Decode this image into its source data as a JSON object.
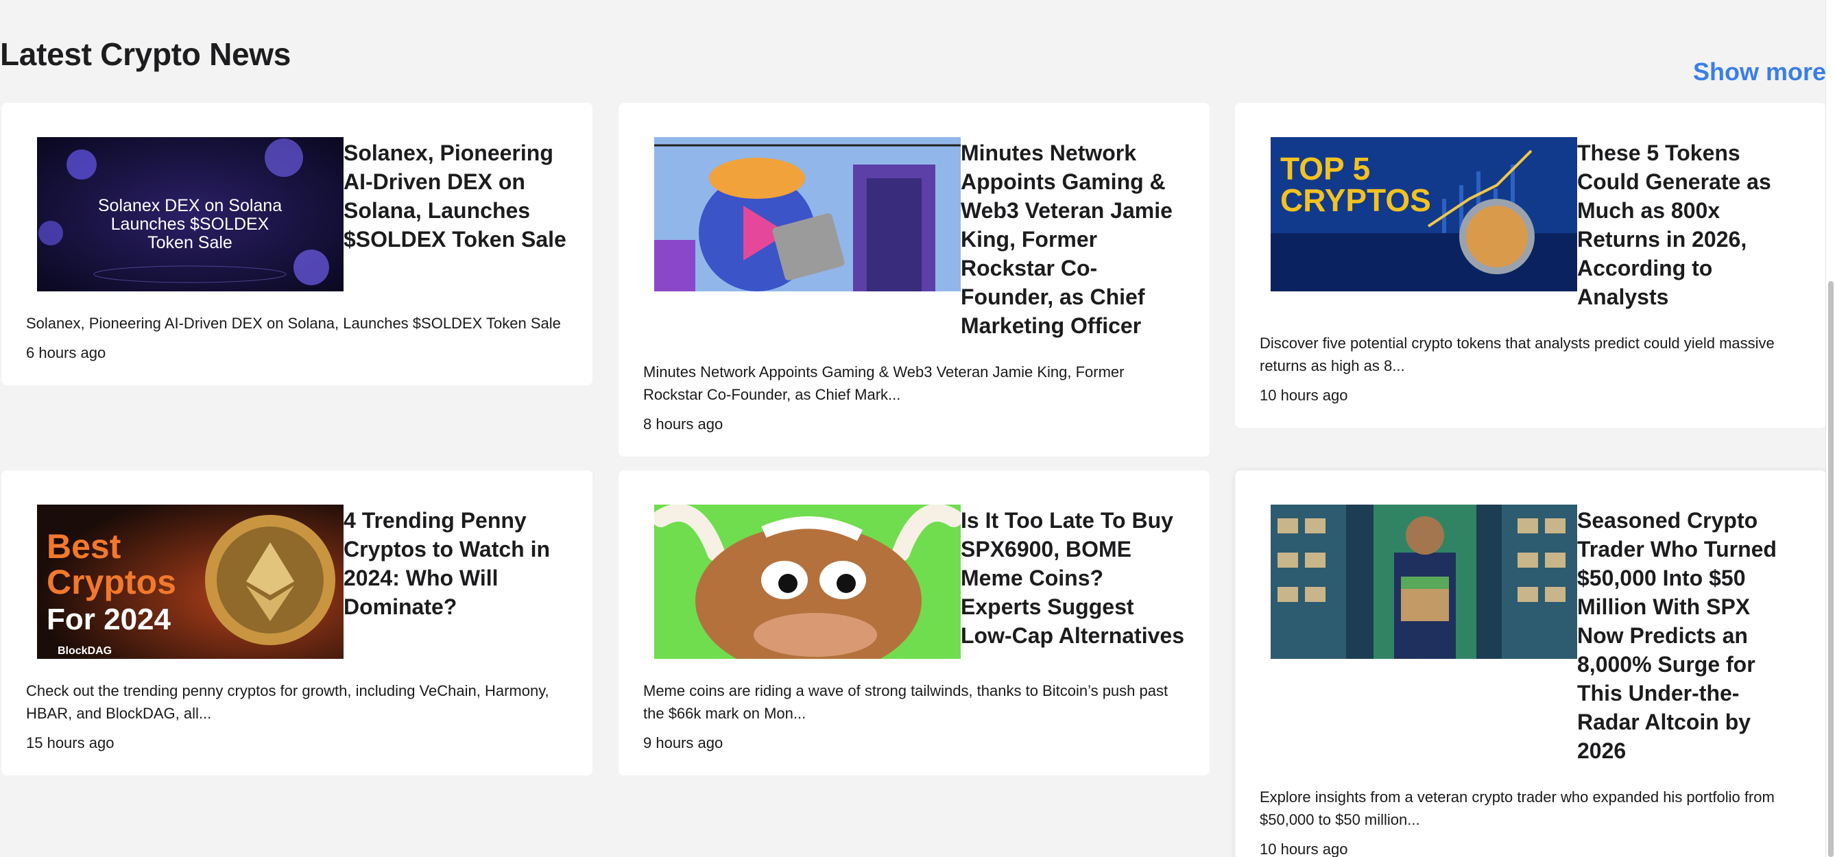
{
  "section": {
    "title": "Latest Crypto News",
    "show_more": "Show more"
  },
  "articles": [
    {
      "headline": "Solanex, Pioneering AI-Driven DEX on Solana, Launches $SOLDEX Token Sale",
      "image_text": [
        "Solanex DEX on Solana",
        "Launches $SOLDEX",
        "Token Sale"
      ],
      "excerpt": "Solanex, Pioneering AI-Driven DEX on Solana, Launches $SOLDEX Token Sale",
      "time": "6 hours ago"
    },
    {
      "headline": "Minutes Network Appoints Gaming & Web3 Veteran Jamie King, Former Rockstar Co-Founder, as Chief Marketing Officer",
      "excerpt": "Minutes Network Appoints Gaming & Web3 Veteran Jamie King, Former Rockstar Co-Founder, as Chief Mark...",
      "time": "8 hours ago"
    },
    {
      "headline": "These 5 Tokens Could Generate as Much as 800x Returns in 2026, According to Analysts",
      "image_text": [
        "TOP 5",
        "CRYPTOS"
      ],
      "excerpt": "Discover five potential crypto tokens that analysts predict could yield massive returns as high as 8...",
      "time": "10 hours ago"
    },
    {
      "headline": "4 Trending Penny Cryptos to Watch in 2024: Who Will Dominate?",
      "image_text": [
        "Best",
        "Cryptos",
        "For 2024",
        "BlockDAG"
      ],
      "excerpt": "Check out the trending penny cryptos for growth, including VeChain, Harmony, HBAR, and BlockDAG, all...",
      "time": "15 hours ago"
    },
    {
      "headline": "Is It Too Late To Buy SPX6900, BOME Meme Coins? Experts Suggest Low-Cap Alternatives",
      "excerpt": "Meme coins are riding a wave of strong tailwinds, thanks to Bitcoin’s push past the $66k mark on Mon...",
      "time": "9 hours ago"
    },
    {
      "headline": "Seasoned Crypto Trader Who Turned $50,000 Into $50 Million With SPX Now Predicts an 8,000% Surge for This Under-the-Radar Altcoin by 2026",
      "excerpt": "Explore insights from a veteran crypto trader who expanded his portfolio from $50,000 to $50 million...",
      "time": "10 hours ago"
    }
  ],
  "colors": {
    "accent": "#3a7ee8",
    "background": "#f3f3f3",
    "card": "#ffffff"
  }
}
